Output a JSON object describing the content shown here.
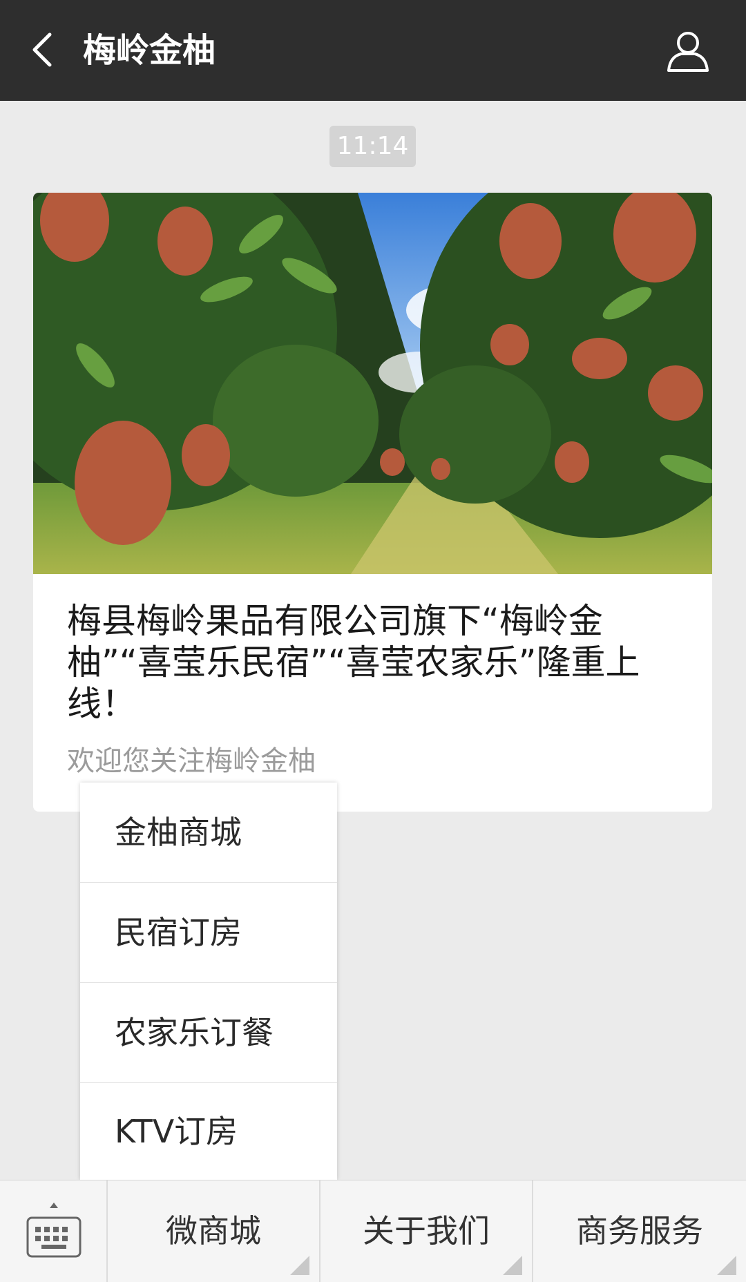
{
  "header": {
    "title": "梅岭金柚",
    "back_icon": "chevron-left-icon",
    "profile_icon": "person-icon"
  },
  "chat": {
    "time": "11:14"
  },
  "article": {
    "title": "梅县梅岭果品有限公司旗下“梅岭金柚”“喜莹乐民宿”“喜莹农家乐”隆重上线！",
    "subtitle": "欢迎您关注梅岭金柚",
    "image": "orchard-photo"
  },
  "popup_menu": {
    "items": [
      {
        "label": "金柚商城"
      },
      {
        "label": "民宿订房"
      },
      {
        "label": "农家乐订餐"
      },
      {
        "label": "KTV订房"
      }
    ]
  },
  "bottom_menu": {
    "keyboard_icon": "keyboard-icon",
    "tabs": [
      {
        "label": "微商城"
      },
      {
        "label": "关于我们"
      },
      {
        "label": "商务服务"
      }
    ]
  },
  "colors": {
    "header_bg": "#2e2e2e",
    "page_bg": "#ebebeb"
  }
}
